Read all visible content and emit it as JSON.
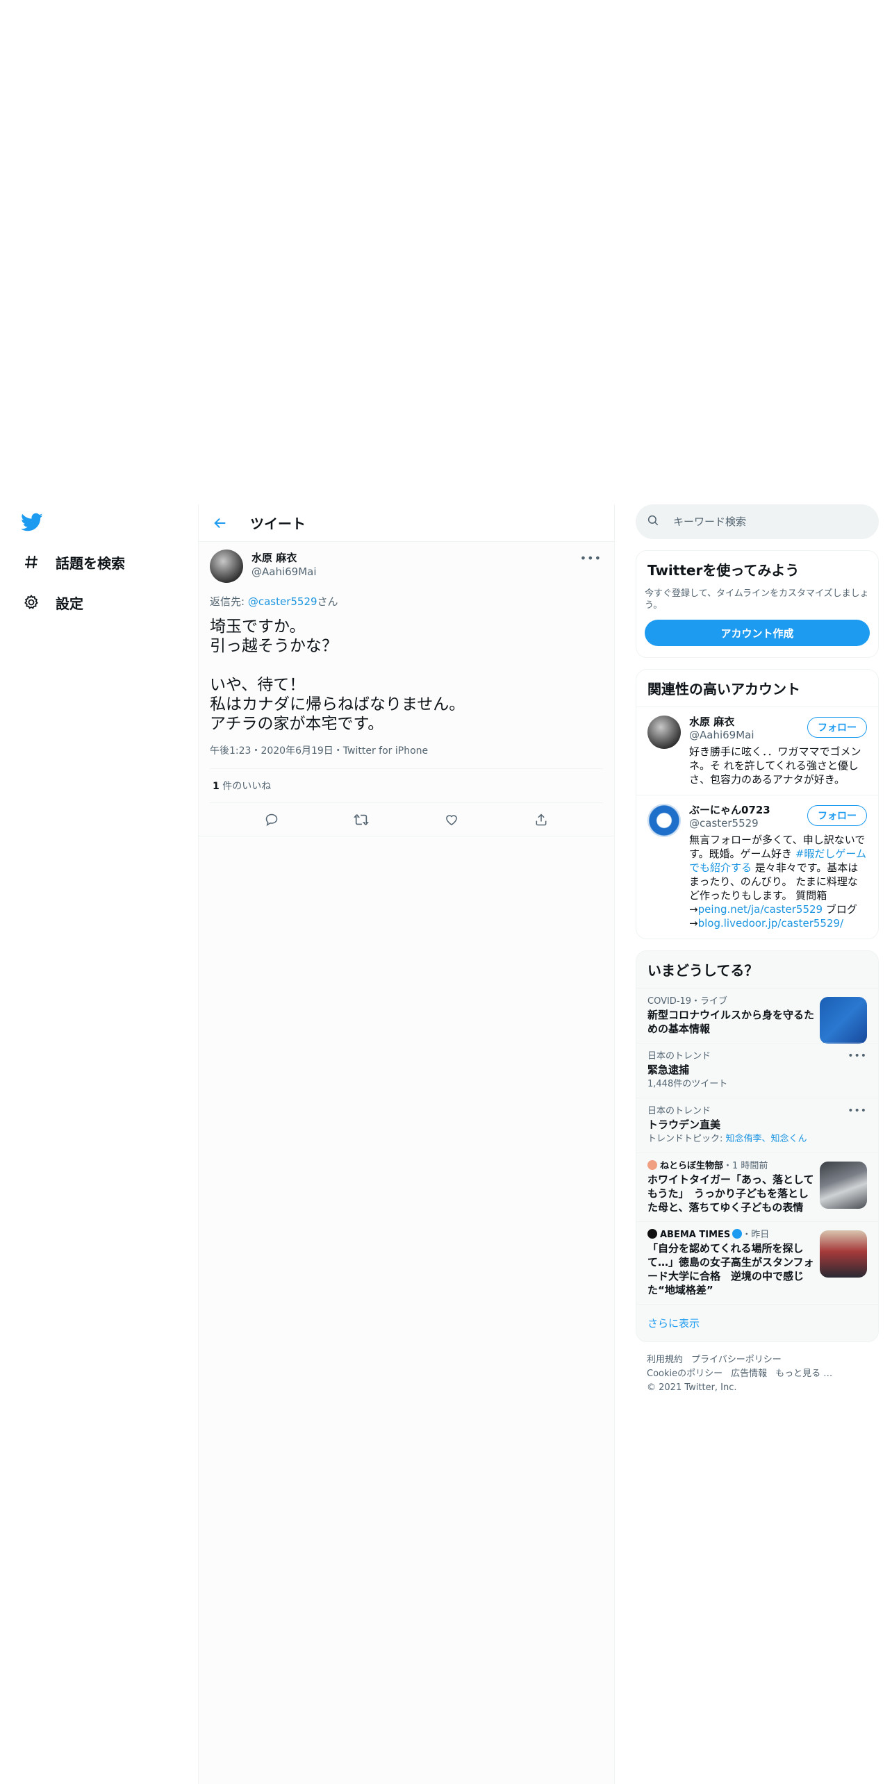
{
  "nav": {
    "explore_label": "話題を検索",
    "settings_label": "設定"
  },
  "header": {
    "title": "ツイート"
  },
  "tweet": {
    "display_name": "水原 麻衣",
    "handle": "@Aahi69Mai",
    "reply_prefix": "返信先: ",
    "reply_handle": "@caster5529",
    "reply_suffix": "さん",
    "text": "埼玉ですか。\n引っ越そうかな？\n\nいや、待て！\n私はカナダに帰らねばなりません。\nアチラの家が本宅です。",
    "meta": "午後1:23・2020年6月19日・Twitter for iPhone",
    "likes_count": "1",
    "likes_label": " 件のいいね"
  },
  "search": {
    "placeholder": "キーワード検索"
  },
  "signup": {
    "title": "Twitterを使ってみよう",
    "description": "今すぐ登録して、タイムラインをカスタマイズしましょう。",
    "button": "アカウント作成"
  },
  "related": {
    "title": "関連性の高いアカウント",
    "follow_label": "フォロー",
    "accounts": [
      {
        "name": "水原 麻衣",
        "handle": "@Aahi69Mai",
        "bio": "好き勝手に呟く．．ワガママでゴメンネ。そ れを許してくれる強さと優しさ、包容力のあるアナタが好き。"
      },
      {
        "name": "ぶーにゃん0723",
        "handle": "@caster5529",
        "bio_1": "無言フォローが多くて、申し訳ないです。既婚。ゲーム好き ",
        "bio_tag": "#暇だしゲームでも紹介する",
        "bio_2": " 是々非々です。基本はまったり、のんびり。 たまに料理など作ったりもします。 質問箱→",
        "bio_link1": "peing.net/ja/caster5529",
        "bio_3": " ブログ→",
        "bio_link2": "blog.livedoor.jp/caster5529/"
      }
    ]
  },
  "trends": {
    "title": "いまどうしてる？",
    "items": [
      {
        "context": "COVID-19・ライブ",
        "title": "新型コロナウイルスから身を守るための基本情報"
      },
      {
        "context": "日本のトレンド",
        "title": "緊急逮捕",
        "sub": "1,448件のツイート"
      },
      {
        "context": "日本のトレンド",
        "title": "トラウデン直美",
        "sub_prefix": "トレンドトピック: ",
        "sub_links": "知念侑李、知念くん"
      },
      {
        "source": "ねとらぼ生物部",
        "time": "・1 時間前",
        "title": "ホワイトタイガー「あっ、落としてもうた」　うっかり子どもを落とした母と、落ちてゆく子どもの表情"
      },
      {
        "source": "ABEMA TIMES",
        "time": "・昨日",
        "title": "「自分を認めてくれる場所を探して…」徳島の女子高生がスタンフォード大学に合格　逆境の中で感じた“地域格差”"
      }
    ],
    "show_more": "さらに表示"
  },
  "footer": {
    "terms": "利用規約",
    "privacy": "プライバシーポリシー",
    "cookie": "Cookieのポリシー",
    "ads": "広告情報",
    "more": "もっと見る …",
    "copyright": "© 2021 Twitter, Inc."
  },
  "colors": {
    "accent": "#1d9bf0",
    "text_secondary": "#536471",
    "border": "#eff3f4"
  }
}
